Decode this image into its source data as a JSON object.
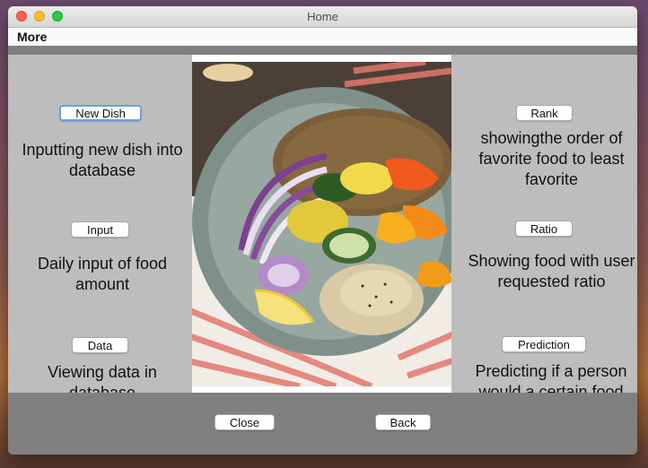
{
  "window": {
    "title": "Home"
  },
  "menu": {
    "more_label": "More"
  },
  "left": [
    {
      "button": "New Dish",
      "description": "Inputting new dish into database"
    },
    {
      "button": "Input",
      "description": "Daily input of food amount"
    },
    {
      "button": "Data",
      "description": "Viewing data in database"
    }
  ],
  "right": [
    {
      "button": "Rank",
      "description": "showingthe order of favorite food to least favorite"
    },
    {
      "button": "Ratio",
      "description": "Showing food with user requested ratio"
    },
    {
      "button": "Prediction",
      "description": "Predicting if a person would a certain food"
    }
  ],
  "footer": {
    "close_label": "Close",
    "back_label": "Back"
  },
  "image": {
    "subject": "food-bowl-image"
  }
}
